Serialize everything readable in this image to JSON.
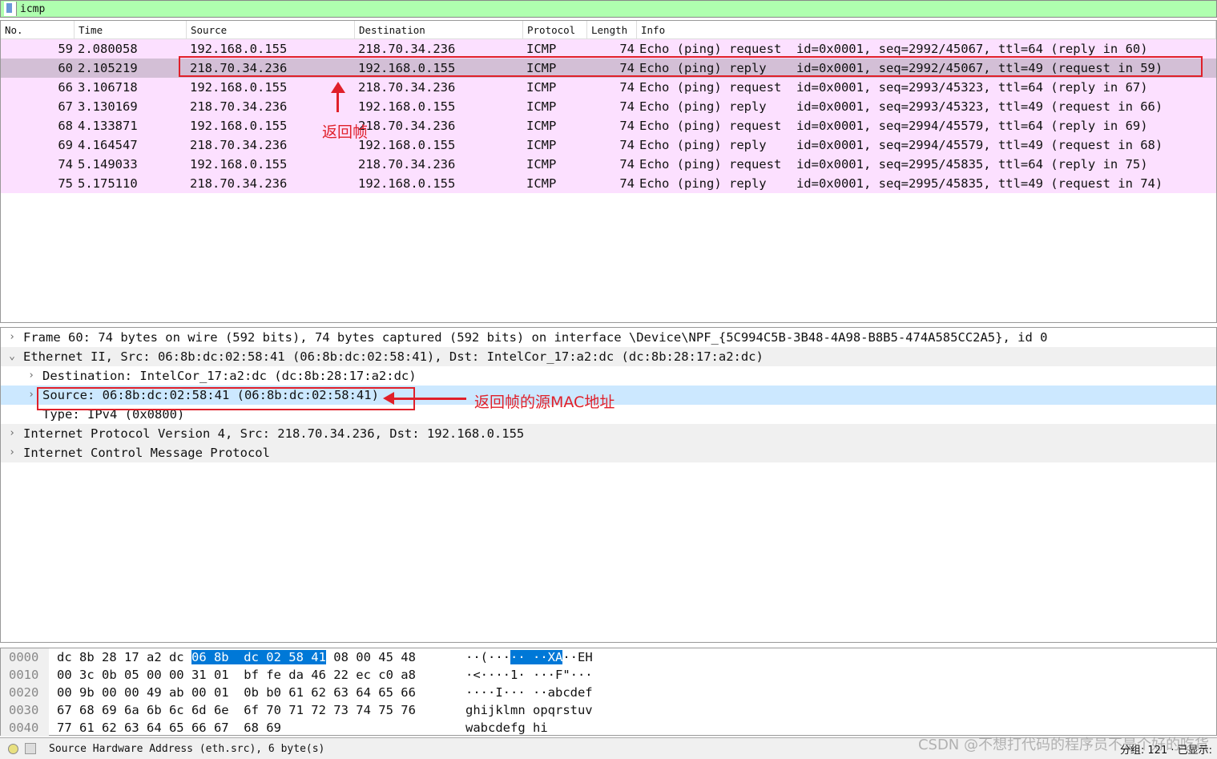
{
  "filter": {
    "value": "icmp"
  },
  "columns": [
    "No.",
    "Time",
    "Source",
    "Destination",
    "Protocol",
    "Length",
    "Info"
  ],
  "packets": [
    [
      "59",
      "2.080058",
      "192.168.0.155",
      "218.70.34.236",
      "ICMP",
      "74",
      "Echo (ping) request  id=0x0001, seq=2992/45067, ttl=64 (reply in 60)"
    ],
    [
      "60",
      "2.105219",
      "218.70.34.236",
      "192.168.0.155",
      "ICMP",
      "74",
      "Echo (ping) reply    id=0x0001, seq=2992/45067, ttl=49 (request in 59)"
    ],
    [
      "66",
      "3.106718",
      "192.168.0.155",
      "218.70.34.236",
      "ICMP",
      "74",
      "Echo (ping) request  id=0x0001, seq=2993/45323, ttl=64 (reply in 67)"
    ],
    [
      "67",
      "3.130169",
      "218.70.34.236",
      "192.168.0.155",
      "ICMP",
      "74",
      "Echo (ping) reply    id=0x0001, seq=2993/45323, ttl=49 (request in 66)"
    ],
    [
      "68",
      "4.133871",
      "192.168.0.155",
      "218.70.34.236",
      "ICMP",
      "74",
      "Echo (ping) request  id=0x0001, seq=2994/45579, ttl=64 (reply in 69)"
    ],
    [
      "69",
      "4.164547",
      "218.70.34.236",
      "192.168.0.155",
      "ICMP",
      "74",
      "Echo (ping) reply    id=0x0001, seq=2994/45579, ttl=49 (request in 68)"
    ],
    [
      "74",
      "5.149033",
      "192.168.0.155",
      "218.70.34.236",
      "ICMP",
      "74",
      "Echo (ping) request  id=0x0001, seq=2995/45835, ttl=64 (reply in 75)"
    ],
    [
      "75",
      "5.175110",
      "218.70.34.236",
      "192.168.0.155",
      "ICMP",
      "74",
      "Echo (ping) reply    id=0x0001, seq=2995/45835, ttl=49 (request in 74)"
    ]
  ],
  "annotations": {
    "return_frame": "返回帧",
    "source_mac": "返回帧的源MAC地址"
  },
  "details": [
    "Frame 60: 74 bytes on wire (592 bits), 74 bytes captured (592 bits) on interface \\Device\\NPF_{5C994C5B-3B48-4A98-B8B5-474A585CC2A5}, id 0",
    "Ethernet II, Src: 06:8b:dc:02:58:41 (06:8b:dc:02:58:41), Dst: IntelCor_17:a2:dc (dc:8b:28:17:a2:dc)",
    "Destination: IntelCor_17:a2:dc (dc:8b:28:17:a2:dc)",
    "Source: 06:8b:dc:02:58:41 (06:8b:dc:02:58:41)",
    "Type: IPv4 (0x0800)",
    "Internet Protocol Version 4, Src: 218.70.34.236, Dst: 192.168.0.155",
    "Internet Control Message Protocol"
  ],
  "hex": [
    {
      "off": "0000",
      "pre": "dc 8b 28 17 a2 dc ",
      "sel": "06 8b  dc 02 58 41",
      "post": " 08 00 45 48",
      "apre": "··(···",
      "asel": "·· ··XA",
      "apost": "··EH"
    },
    {
      "off": "0010",
      "pre": "00 3c 0b 05 00 00 31 01  bf fe da 46 22 ec c0 a8",
      "sel": "",
      "post": "",
      "apre": "·<····1· ···F\"···",
      "asel": "",
      "apost": ""
    },
    {
      "off": "0020",
      "pre": "00 9b 00 00 49 ab 00 01  0b b0 61 62 63 64 65 66",
      "sel": "",
      "post": "",
      "apre": "····I··· ··abcdef",
      "asel": "",
      "apost": ""
    },
    {
      "off": "0030",
      "pre": "67 68 69 6a 6b 6c 6d 6e  6f 70 71 72 73 74 75 76",
      "sel": "",
      "post": "",
      "apre": "ghijklmn opqrstuv",
      "asel": "",
      "apost": ""
    },
    {
      "off": "0040",
      "pre": "77 61 62 63 64 65 66 67  68 69",
      "sel": "",
      "post": "",
      "apre": "wabcdefg hi",
      "asel": "",
      "apost": ""
    }
  ],
  "status": {
    "field": "Source Hardware Address (eth.src), 6 byte(s)",
    "counts": "分组: 121 · 已显示: ",
    "watermark": "CSDN @不想打代码的程序员不是个好的吃货"
  }
}
